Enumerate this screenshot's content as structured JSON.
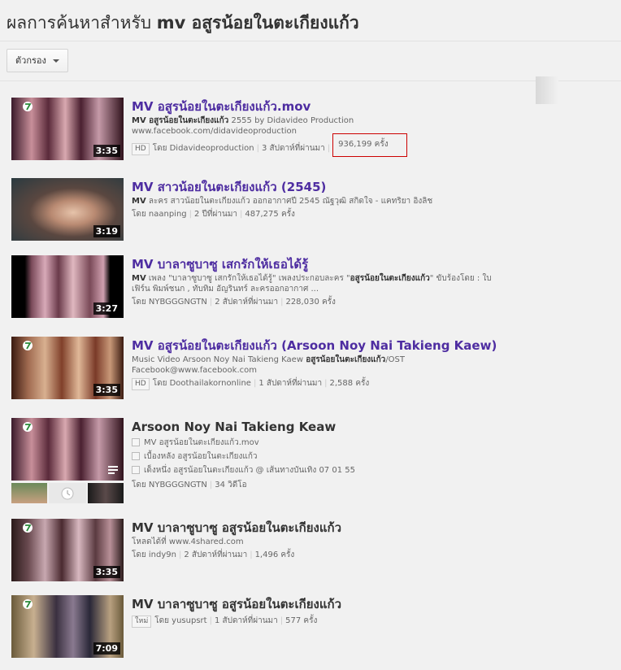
{
  "header": {
    "title_prefix": "ผลการค้นหาสำหรับ ",
    "title_query": "mv อสูรน้อยในตะเกียงแก้ว"
  },
  "filter": {
    "label": "ตัวกรอง"
  },
  "colors": {
    "title_link": "#4e2da1",
    "highlight_box": "#cc0000"
  },
  "results": [
    {
      "title": "MV อสูรน้อยในตะเกียงแก้ว.mov",
      "duration": "3:35",
      "desc_bold": "MV อสูรน้อยในตะเกียงแก้ว",
      "desc_rest": " 2555 by Didavideo Production",
      "desc_line2": "www.facebook.com/didavideoproduction",
      "badge": "HD",
      "author_prefix": "โดย ",
      "author": "Didavideoproduction",
      "age": "3 สัปดาห์ที่ผ่านมา",
      "views": "936,199 ครั้ง"
    },
    {
      "title": "MV สาวน้อยในตะเกียงแก้ว (2545)",
      "duration": "3:19",
      "desc_bold": "MV",
      "desc_rest": " ละคร สาวน้อยในตะเกียงแก้ว ออกอากาศปี 2545 ณัฐวุฒิ สกิดใจ - แคทริยา อิงลิช",
      "author_prefix": "โดย ",
      "author": "naanping",
      "age": "2 ปีที่ผ่านมา",
      "views": "487,275 ครั้ง"
    },
    {
      "title": "MV บาลาซูบาซู เสกรักให้เธอได้รู้",
      "duration": "3:27",
      "desc_bold": "MV",
      "desc_rest": " เพลง \"บาลาซูบาซู เสกรักให้เธอได้รู้\" เพลงประกอบละคร \"",
      "desc_bold2": "อสูรน้อยในตะเกียงแก้ว",
      "desc_rest2": "\" ขับร้องโดย : ใบ",
      "desc_line2": "เฟิร์น พิมพ์ชนก , ทับทิม อัญรินทร์ ละครออกอากาศ ...",
      "author_prefix": "โดย ",
      "author": "NYBGGGNGTN",
      "age": "2 สัปดาห์ที่ผ่านมา",
      "views": "228,030 ครั้ง"
    },
    {
      "title": "MV อสูรน้อยในตะเกียงแก้ว (Arsoon Noy Nai Takieng Kaew)",
      "duration": "3:35",
      "desc_rest": "Music Video Arsoon Noy Nai Takieng Kaew ",
      "desc_bold2": "อสูรน้อยในตะเกียงแก้ว",
      "desc_rest2": "/OST",
      "desc_line2": "Facebook@www.facebook.com",
      "badge": "HD",
      "author_prefix": "โดย ",
      "author": "Doothailakornonline",
      "age": "1 สัปดาห์ที่ผ่านมา",
      "views": "2,588 ครั้ง"
    },
    {
      "title": "Arsoon Noy Nai Takieng Keaw",
      "duration": "",
      "playlist": [
        "MV อสูรน้อยในตะเกียงแก้ว.mov",
        "เบื้องหลัง อสูรน้อยในตะเกียงแก้ว",
        "เด็งหนึ่ง อสูรน้อยในตะเกียงแก้ว @ เส้นทางบันเทิง 07 01 55"
      ],
      "author_prefix": "โดย ",
      "author": "NYBGGGNGTN",
      "count": "34 วิดีโอ"
    },
    {
      "title": "MV บาลาซูบาซู อสูรน้อยในตะเกียงแก้ว",
      "duration": "3:35",
      "desc_rest": "โหลดได้ที่ www.4shared.com",
      "author_prefix": "โดย ",
      "author": "indy9n",
      "age": "2 สัปดาห์ที่ผ่านมา",
      "views": "1,496 ครั้ง"
    },
    {
      "title": "MV บาลาซูบาซู อสูรน้อยในตะเกียงแก้ว",
      "duration": "7:09",
      "badge": "ใหม่",
      "author_prefix": "โดย ",
      "author": "yusupsrt",
      "age": "1 สัปดาห์ที่ผ่านมา",
      "views": "577 ครั้ง"
    }
  ]
}
